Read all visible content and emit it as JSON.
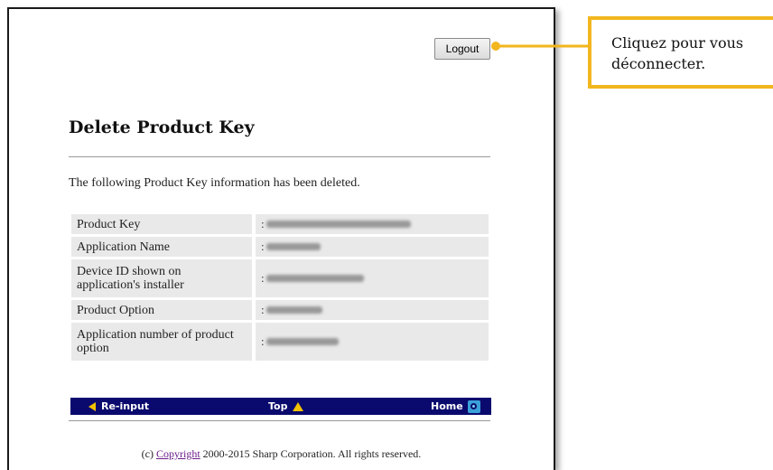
{
  "page": {
    "logout_label": "Logout",
    "title": "Delete Product Key",
    "message": "The following Product Key information has been deleted."
  },
  "details": [
    {
      "label": "Product Key",
      "value": ":"
    },
    {
      "label": "Application Name",
      "value": ":"
    },
    {
      "label": "Device ID shown on application's installer",
      "value": ":"
    },
    {
      "label": "Product Option",
      "value": ":"
    },
    {
      "label": "Application number of product option",
      "value": ":"
    }
  ],
  "nav": {
    "reinput_label": "Re-input",
    "top_label": "Top",
    "home_label": "Home"
  },
  "footer": {
    "prefix": "(c) ",
    "link_label": "Copyright",
    "suffix": " 2000-2015 Sharp Corporation. All rights reserved."
  },
  "callout": {
    "text": "Cliquez pour vous déconnecter."
  },
  "colors": {
    "callout_accent": "#f2b61e",
    "navbar_bg": "#0a0a6e",
    "nav_arrow": "#f2c200"
  }
}
